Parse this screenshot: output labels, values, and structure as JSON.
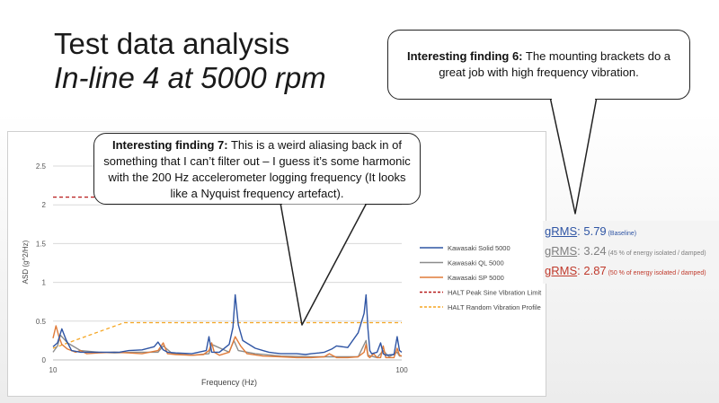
{
  "slide": {
    "title_line1": "Test data analysis",
    "title_line2": "In-line 4 at 5000 rpm"
  },
  "callouts": {
    "finding6_label": "Interesting finding 6:",
    "finding6_text": " The mounting brackets do a great job with high frequency vibration.",
    "finding7_label": "Interesting finding 7:",
    "finding7_text": " This is a weird aliasing back in of something that I can’t filter out – I guess it’s some harmonic with the 200 Hz accelerometer logging frequency (It looks like a Nyquist frequency artefact)."
  },
  "grms": [
    {
      "label": "gRMS",
      "value": ": 5.79",
      "note": " (Baseline)",
      "color": "#2f55a4"
    },
    {
      "label": "gRMS",
      "value": ": 3.24",
      "note": " (45 % of energy isolated / damped)",
      "color": "#808080"
    },
    {
      "label": "gRMS",
      "value": ": 2.87",
      "note": " (50 % of energy isolated / damped)",
      "color": "#c0392b"
    }
  ],
  "chart_data": {
    "type": "line",
    "xlabel": "Frequency (Hz)",
    "ylabel": "ASD (g^2/Hz)",
    "xscale": "log",
    "xlim": [
      10,
      100
    ],
    "ylim": [
      0,
      2.5
    ],
    "xticks": [
      10,
      100
    ],
    "xtick_labels": [
      "10",
      "100"
    ],
    "yticks": [
      0,
      0.5,
      1,
      1.5,
      2,
      2.5
    ],
    "ytick_labels": [
      "0",
      "0.5",
      "1",
      "1.5",
      "2",
      "2.5"
    ],
    "grid": "horizontal",
    "legend_position": "right",
    "series": [
      {
        "name": "Kawasaki Solid 5000",
        "color": "#2f55a4",
        "style": "solid",
        "x": [
          10,
          10.3,
          10.6,
          10.9,
          11.3,
          12,
          13,
          14.5,
          15.5,
          16.5,
          18,
          19.5,
          20,
          20.7,
          21.3,
          22.5,
          25,
          27.5,
          28,
          28.5,
          30,
          32,
          32.8,
          33.3,
          34,
          35,
          38,
          40,
          41.6,
          43,
          45,
          48,
          50,
          53,
          55,
          58,
          60,
          63,
          65,
          70,
          75,
          78,
          79,
          80,
          81,
          82,
          85,
          87,
          88.5,
          90,
          95,
          97,
          98.5,
          100
        ],
        "y": [
          0.17,
          0.22,
          0.4,
          0.26,
          0.12,
          0.1,
          0.1,
          0.1,
          0.1,
          0.12,
          0.13,
          0.17,
          0.23,
          0.13,
          0.1,
          0.09,
          0.08,
          0.12,
          0.3,
          0.1,
          0.1,
          0.2,
          0.42,
          0.84,
          0.45,
          0.25,
          0.15,
          0.12,
          0.1,
          0.09,
          0.08,
          0.08,
          0.08,
          0.07,
          0.08,
          0.09,
          0.1,
          0.14,
          0.18,
          0.16,
          0.35,
          0.6,
          0.84,
          0.4,
          0.12,
          0.08,
          0.1,
          0.22,
          0.08,
          0.06,
          0.07,
          0.3,
          0.12,
          0.1
        ]
      },
      {
        "name": "Kawasaki QL 5000",
        "color": "#8c8c8c",
        "style": "solid",
        "x": [
          10,
          10.3,
          10.5,
          11,
          12,
          13.5,
          15,
          17,
          20,
          20.7,
          22,
          25,
          28,
          28.5,
          32,
          33,
          34,
          38,
          45,
          55,
          65,
          75,
          79,
          80,
          85,
          88.5,
          92,
          97,
          98.5,
          100
        ],
        "y": [
          0.1,
          0.18,
          0.32,
          0.22,
          0.12,
          0.1,
          0.09,
          0.1,
          0.1,
          0.18,
          0.08,
          0.06,
          0.08,
          0.2,
          0.1,
          0.25,
          0.12,
          0.08,
          0.05,
          0.04,
          0.04,
          0.04,
          0.25,
          0.06,
          0.03,
          0.12,
          0.04,
          0.1,
          0.05,
          0.05
        ]
      },
      {
        "name": "Kawasaki SP 5000",
        "color": "#e07b39",
        "style": "solid",
        "x": [
          10,
          10.2,
          10.4,
          10.6,
          11,
          11.6,
          12,
          12.5,
          13.5,
          15,
          16.5,
          18,
          20,
          20.7,
          21.3,
          22.5,
          25,
          27,
          28,
          28.5,
          29,
          30,
          32,
          33.3,
          34.5,
          36,
          40,
          45,
          50,
          55,
          60,
          62,
          65,
          70,
          75,
          78,
          79,
          80,
          81,
          83,
          85,
          87,
          88.5,
          90,
          95,
          97,
          98.5,
          100
        ],
        "y": [
          0.28,
          0.44,
          0.3,
          0.2,
          0.14,
          0.1,
          0.12,
          0.08,
          0.09,
          0.1,
          0.09,
          0.08,
          0.12,
          0.22,
          0.08,
          0.07,
          0.06,
          0.07,
          0.12,
          0.22,
          0.1,
          0.06,
          0.1,
          0.3,
          0.18,
          0.08,
          0.05,
          0.04,
          0.03,
          0.03,
          0.04,
          0.08,
          0.03,
          0.03,
          0.04,
          0.1,
          0.2,
          0.05,
          0.03,
          0.08,
          0.03,
          0.03,
          0.18,
          0.03,
          0.03,
          0.15,
          0.06,
          0.05
        ]
      },
      {
        "name": "HALT Peak Sine Vibration Limit",
        "color": "#b71c1c",
        "style": "dashed",
        "x": [
          10,
          20
        ],
        "y": [
          2.1,
          2.1
        ]
      },
      {
        "name": "HALT Random Vibration Profile",
        "color": "#f5a623",
        "style": "dashed",
        "x": [
          10,
          16,
          100
        ],
        "y": [
          0.15,
          0.48,
          0.48
        ]
      }
    ]
  }
}
